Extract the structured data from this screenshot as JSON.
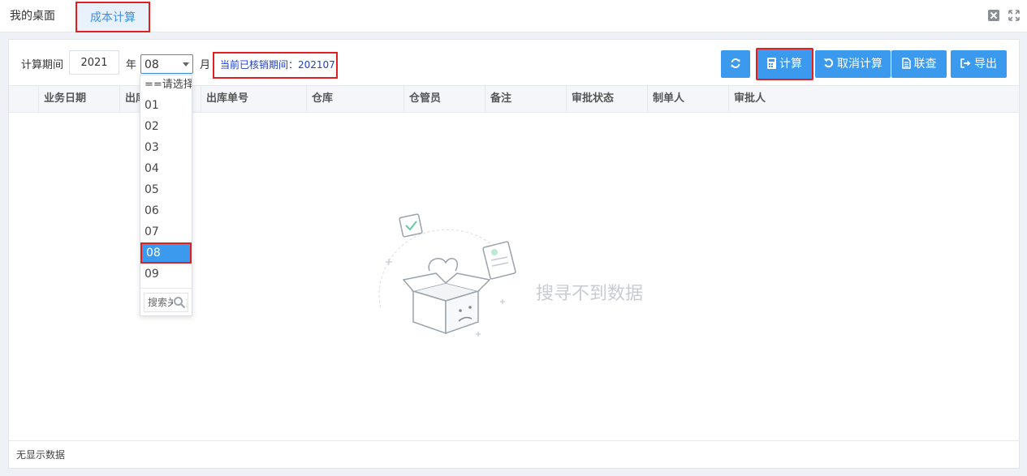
{
  "tabs": {
    "home": "我的桌面",
    "active": "成本计算"
  },
  "toolbar": {
    "period_label": "计算期间",
    "year": "2021",
    "year_unit": "年",
    "month": "08",
    "month_unit": "月",
    "verified_period": "当前已核销期间：202107",
    "buttons": {
      "calc": "计算",
      "cancel": "取消计算",
      "query": "联查",
      "export": "导出"
    }
  },
  "table": {
    "columns": [
      "业务日期",
      "出库类型",
      "出库单号",
      "仓库",
      "仓管员",
      "备注",
      "审批状态",
      "制单人",
      "审批人"
    ],
    "empty_text": "搜寻不到数据"
  },
  "footer": {
    "status": "无显示数据"
  },
  "dropdown": {
    "options": [
      "==请选择==",
      "01",
      "02",
      "03",
      "04",
      "05",
      "06",
      "07",
      "08",
      "09"
    ],
    "selected": "08",
    "search_placeholder": "搜索关键字"
  },
  "colors": {
    "accent": "#3b9aee",
    "highlight": "#e02020",
    "period_text": "#1d3fcf"
  }
}
